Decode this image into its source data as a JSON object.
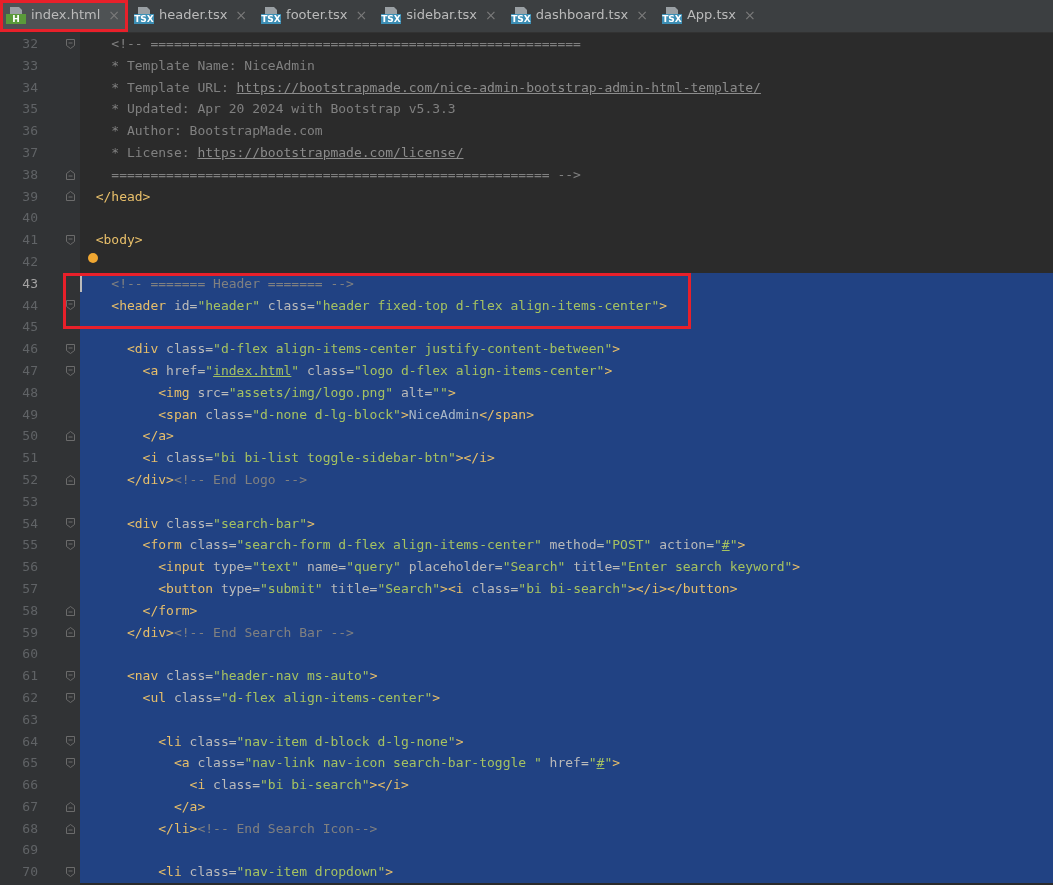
{
  "tabs": [
    {
      "label": "index.html",
      "badge": "H",
      "kind": "html",
      "selected": true,
      "boxed": true
    },
    {
      "label": "header.tsx",
      "badge": "TSX",
      "kind": "tsx",
      "selected": false,
      "boxed": false
    },
    {
      "label": "footer.tsx",
      "badge": "TSX",
      "kind": "tsx",
      "selected": false,
      "boxed": false
    },
    {
      "label": "sidebar.tsx",
      "badge": "TSX",
      "kind": "tsx",
      "selected": false,
      "boxed": false
    },
    {
      "label": "dashboard.tsx",
      "badge": "TSX",
      "kind": "tsx",
      "selected": false,
      "boxed": false
    },
    {
      "label": "App.tsx",
      "badge": "TSX",
      "kind": "tsx",
      "selected": false,
      "boxed": false
    }
  ],
  "close_glyph": "×",
  "lines": [
    {
      "number": "32",
      "kind": "fold-start",
      "selected": false,
      "boxed": false,
      "caret": false,
      "bulb": false,
      "tokens": [
        {
          "kind": "comment",
          "text": "  <!-- ======================================================="
        }
      ]
    },
    {
      "number": "33",
      "kind": "plain",
      "selected": false,
      "boxed": false,
      "caret": false,
      "bulb": false,
      "tokens": [
        {
          "kind": "comment",
          "text": "  * Template Name: NiceAdmin"
        }
      ]
    },
    {
      "number": "34",
      "kind": "plain",
      "selected": false,
      "boxed": false,
      "caret": false,
      "bulb": false,
      "tokens": [
        {
          "kind": "comment",
          "text": "  * Template URL: "
        },
        {
          "kind": "clink",
          "text": "https://bootstrapmade.com/nice-admin-bootstrap-admin-html-template/"
        }
      ]
    },
    {
      "number": "35",
      "kind": "plain",
      "selected": false,
      "boxed": false,
      "caret": false,
      "bulb": false,
      "tokens": [
        {
          "kind": "comment",
          "text": "  * Updated: Apr 20 2024 with Bootstrap v5.3.3"
        }
      ]
    },
    {
      "number": "36",
      "kind": "plain",
      "selected": false,
      "boxed": false,
      "caret": false,
      "bulb": false,
      "tokens": [
        {
          "kind": "comment",
          "text": "  * Author: BootstrapMade.com"
        }
      ]
    },
    {
      "number": "37",
      "kind": "plain",
      "selected": false,
      "boxed": false,
      "caret": false,
      "bulb": false,
      "tokens": [
        {
          "kind": "comment",
          "text": "  * License: "
        },
        {
          "kind": "clink",
          "text": "https://bootstrapmade.com/license/"
        }
      ]
    },
    {
      "number": "38",
      "kind": "fold-end",
      "selected": false,
      "boxed": false,
      "caret": false,
      "bulb": false,
      "tokens": [
        {
          "kind": "comment",
          "text": "  ======================================================== -->"
        }
      ]
    },
    {
      "number": "39",
      "kind": "fold-end",
      "selected": false,
      "boxed": false,
      "caret": false,
      "bulb": false,
      "tokens": [
        {
          "kind": "tag",
          "text": "</head>"
        }
      ]
    },
    {
      "number": "40",
      "kind": "plain",
      "selected": false,
      "boxed": false,
      "caret": false,
      "bulb": false
    },
    {
      "number": "41",
      "kind": "fold-start",
      "selected": false,
      "boxed": false,
      "caret": false,
      "bulb": false,
      "tokens": [
        {
          "kind": "tag",
          "text": "<body>"
        }
      ]
    },
    {
      "number": "42",
      "kind": "plain",
      "selected": false,
      "boxed": false,
      "caret": false,
      "bulb": true
    },
    {
      "number": "43",
      "kind": "plain",
      "selected": true,
      "boxed": true,
      "caret": true,
      "bulb": false,
      "tokens": [
        {
          "kind": "comment",
          "text": "  <!-- ======= Header ======= -->"
        }
      ]
    },
    {
      "number": "44",
      "kind": "fold-start",
      "selected": true,
      "boxed": true,
      "caret": false,
      "bulb": false,
      "tokens": [
        {
          "kind": "tag",
          "text": "  <header"
        },
        {
          "kind": "attr",
          "text": " id="
        },
        {
          "kind": "str",
          "text": "\"header\""
        },
        {
          "kind": "attr",
          "text": " class="
        },
        {
          "kind": "str",
          "text": "\"header fixed-top d-flex align-items-center\""
        },
        {
          "kind": "tag",
          "text": ">"
        }
      ]
    },
    {
      "number": "45",
      "kind": "plain",
      "selected": true,
      "boxed": false,
      "caret": false,
      "bulb": false
    },
    {
      "number": "46",
      "kind": "fold-start",
      "selected": true,
      "boxed": false,
      "caret": false,
      "bulb": false,
      "tokens": [
        {
          "kind": "tag",
          "text": "    <div"
        },
        {
          "kind": "attr",
          "text": " class="
        },
        {
          "kind": "str",
          "text": "\"d-flex align-items-center justify-content-between\""
        },
        {
          "kind": "tag",
          "text": ">"
        }
      ]
    },
    {
      "number": "47",
      "kind": "fold-start",
      "selected": true,
      "boxed": false,
      "caret": false,
      "bulb": false,
      "tokens": [
        {
          "kind": "tag",
          "text": "      <a"
        },
        {
          "kind": "attr",
          "text": " href="
        },
        {
          "kind": "str",
          "text": "\""
        },
        {
          "kind": "link",
          "text": "index.html"
        },
        {
          "kind": "str",
          "text": "\""
        },
        {
          "kind": "attr",
          "text": " class="
        },
        {
          "kind": "str",
          "text": "\"logo d-flex align-items-center\""
        },
        {
          "kind": "tag",
          "text": ">"
        }
      ]
    },
    {
      "number": "48",
      "kind": "plain",
      "selected": true,
      "boxed": false,
      "caret": false,
      "bulb": false,
      "tokens": [
        {
          "kind": "tag",
          "text": "        <img"
        },
        {
          "kind": "attr",
          "text": " src="
        },
        {
          "kind": "str",
          "text": "\"assets/img/logo.png\""
        },
        {
          "kind": "attr",
          "text": " alt="
        },
        {
          "kind": "str",
          "text": "\"\""
        },
        {
          "kind": "tag",
          "text": ">"
        }
      ]
    },
    {
      "number": "49",
      "kind": "plain",
      "selected": true,
      "boxed": false,
      "caret": false,
      "bulb": false,
      "tokens": [
        {
          "kind": "tag",
          "text": "        <span"
        },
        {
          "kind": "attr",
          "text": " class="
        },
        {
          "kind": "str",
          "text": "\"d-none d-lg-block\""
        },
        {
          "kind": "tag",
          "text": ">"
        },
        {
          "kind": "text",
          "text": "NiceAdmin"
        },
        {
          "kind": "tag",
          "text": "</span>"
        }
      ]
    },
    {
      "number": "50",
      "kind": "fold-end",
      "selected": true,
      "boxed": false,
      "caret": false,
      "bulb": false,
      "tokens": [
        {
          "kind": "tag",
          "text": "      </a>"
        }
      ]
    },
    {
      "number": "51",
      "kind": "plain",
      "selected": true,
      "boxed": false,
      "caret": false,
      "bulb": false,
      "tokens": [
        {
          "kind": "tag",
          "text": "      <i"
        },
        {
          "kind": "attr",
          "text": " class="
        },
        {
          "kind": "str",
          "text": "\"bi bi-list toggle-sidebar-btn\""
        },
        {
          "kind": "tag",
          "text": "></i>"
        }
      ]
    },
    {
      "number": "52",
      "kind": "fold-end",
      "selected": true,
      "boxed": false,
      "caret": false,
      "bulb": false,
      "tokens": [
        {
          "kind": "tag",
          "text": "    </div>"
        },
        {
          "kind": "comment",
          "text": "<!-- End Logo -->"
        }
      ]
    },
    {
      "number": "53",
      "kind": "plain",
      "selected": true,
      "boxed": false,
      "caret": false,
      "bulb": false
    },
    {
      "number": "54",
      "kind": "fold-start",
      "selected": true,
      "boxed": false,
      "caret": false,
      "bulb": false,
      "tokens": [
        {
          "kind": "tag",
          "text": "    <div"
        },
        {
          "kind": "attr",
          "text": " class="
        },
        {
          "kind": "str",
          "text": "\"search-bar\""
        },
        {
          "kind": "tag",
          "text": ">"
        }
      ]
    },
    {
      "number": "55",
      "kind": "fold-start",
      "selected": true,
      "boxed": false,
      "caret": false,
      "bulb": false,
      "tokens": [
        {
          "kind": "tag",
          "text": "      <form"
        },
        {
          "kind": "attr",
          "text": " class="
        },
        {
          "kind": "str",
          "text": "\"search-form d-flex align-items-center\""
        },
        {
          "kind": "attr",
          "text": " method="
        },
        {
          "kind": "str",
          "text": "\"POST\""
        },
        {
          "kind": "attr",
          "text": " action="
        },
        {
          "kind": "str",
          "text": "\""
        },
        {
          "kind": "link",
          "text": "#"
        },
        {
          "kind": "str",
          "text": "\""
        },
        {
          "kind": "tag",
          "text": ">"
        }
      ]
    },
    {
      "number": "56",
      "kind": "plain",
      "selected": true,
      "boxed": false,
      "caret": false,
      "bulb": false,
      "tokens": [
        {
          "kind": "tag",
          "text": "        <input"
        },
        {
          "kind": "attr",
          "text": " type="
        },
        {
          "kind": "str",
          "text": "\"text\""
        },
        {
          "kind": "attr",
          "text": " name="
        },
        {
          "kind": "str",
          "text": "\"query\""
        },
        {
          "kind": "attr",
          "text": " placeholder="
        },
        {
          "kind": "str",
          "text": "\"Search\""
        },
        {
          "kind": "attr",
          "text": " title="
        },
        {
          "kind": "str",
          "text": "\"Enter search keyword\""
        },
        {
          "kind": "tag",
          "text": ">"
        }
      ]
    },
    {
      "number": "57",
      "kind": "plain",
      "selected": true,
      "boxed": false,
      "caret": false,
      "bulb": false,
      "tokens": [
        {
          "kind": "tag",
          "text": "        <button"
        },
        {
          "kind": "attr",
          "text": " type="
        },
        {
          "kind": "str",
          "text": "\"submit\""
        },
        {
          "kind": "attr",
          "text": " title="
        },
        {
          "kind": "str",
          "text": "\"Search\""
        },
        {
          "kind": "tag",
          "text": "><i"
        },
        {
          "kind": "attr",
          "text": " class="
        },
        {
          "kind": "str",
          "text": "\"bi bi-search\""
        },
        {
          "kind": "tag",
          "text": "></i></button>"
        }
      ]
    },
    {
      "number": "58",
      "kind": "fold-end",
      "selected": true,
      "boxed": false,
      "caret": false,
      "bulb": false,
      "tokens": [
        {
          "kind": "tag",
          "text": "      </form>"
        }
      ]
    },
    {
      "number": "59",
      "kind": "fold-end",
      "selected": true,
      "boxed": false,
      "caret": false,
      "bulb": false,
      "tokens": [
        {
          "kind": "tag",
          "text": "    </div>"
        },
        {
          "kind": "comment",
          "text": "<!-- End Search Bar -->"
        }
      ]
    },
    {
      "number": "60",
      "kind": "plain",
      "selected": true,
      "boxed": false,
      "caret": false,
      "bulb": false
    },
    {
      "number": "61",
      "kind": "fold-start",
      "selected": true,
      "boxed": false,
      "caret": false,
      "bulb": false,
      "tokens": [
        {
          "kind": "tag",
          "text": "    <nav"
        },
        {
          "kind": "attr",
          "text": " class="
        },
        {
          "kind": "str",
          "text": "\"header-nav ms-auto\""
        },
        {
          "kind": "tag",
          "text": ">"
        }
      ]
    },
    {
      "number": "62",
      "kind": "fold-start",
      "selected": true,
      "boxed": false,
      "caret": false,
      "bulb": false,
      "tokens": [
        {
          "kind": "tag",
          "text": "      <ul"
        },
        {
          "kind": "attr",
          "text": " class="
        },
        {
          "kind": "str",
          "text": "\"d-flex align-items-center\""
        },
        {
          "kind": "tag",
          "text": ">"
        }
      ]
    },
    {
      "number": "63",
      "kind": "plain",
      "selected": true,
      "boxed": false,
      "caret": false,
      "bulb": false
    },
    {
      "number": "64",
      "kind": "fold-start",
      "selected": true,
      "boxed": false,
      "caret": false,
      "bulb": false,
      "tokens": [
        {
          "kind": "tag",
          "text": "        <li"
        },
        {
          "kind": "attr",
          "text": " class="
        },
        {
          "kind": "str",
          "text": "\"nav-item d-block d-lg-none\""
        },
        {
          "kind": "tag",
          "text": ">"
        }
      ]
    },
    {
      "number": "65",
      "kind": "fold-start",
      "selected": true,
      "boxed": false,
      "caret": false,
      "bulb": false,
      "tokens": [
        {
          "kind": "tag",
          "text": "          <a"
        },
        {
          "kind": "attr",
          "text": " class="
        },
        {
          "kind": "str",
          "text": "\"nav-link nav-icon search-bar-toggle \""
        },
        {
          "kind": "attr",
          "text": " href="
        },
        {
          "kind": "str",
          "text": "\""
        },
        {
          "kind": "link",
          "text": "#"
        },
        {
          "kind": "str",
          "text": "\""
        },
        {
          "kind": "tag",
          "text": ">"
        }
      ]
    },
    {
      "number": "66",
      "kind": "plain",
      "selected": true,
      "boxed": false,
      "caret": false,
      "bulb": false,
      "tokens": [
        {
          "kind": "tag",
          "text": "            <i"
        },
        {
          "kind": "attr",
          "text": " class="
        },
        {
          "kind": "str",
          "text": "\"bi bi-search\""
        },
        {
          "kind": "tag",
          "text": "></i>"
        }
      ]
    },
    {
      "number": "67",
      "kind": "fold-end",
      "selected": true,
      "boxed": false,
      "caret": false,
      "bulb": false,
      "tokens": [
        {
          "kind": "tag",
          "text": "          </a>"
        }
      ]
    },
    {
      "number": "68",
      "kind": "fold-end",
      "selected": true,
      "boxed": false,
      "caret": false,
      "bulb": false,
      "tokens": [
        {
          "kind": "tag",
          "text": "        </li>"
        },
        {
          "kind": "comment",
          "text": "<!-- End Search Icon-->"
        }
      ]
    },
    {
      "number": "69",
      "kind": "plain",
      "selected": true,
      "boxed": false,
      "caret": false,
      "bulb": false
    },
    {
      "number": "70",
      "kind": "fold-start",
      "selected": true,
      "boxed": false,
      "caret": false,
      "bulb": false,
      "tokens": [
        {
          "kind": "tag",
          "text": "        <li"
        },
        {
          "kind": "attr",
          "text": " class="
        },
        {
          "kind": "str",
          "text": "\"nav-item dropdown\""
        },
        {
          "kind": "tag",
          "text": ">"
        }
      ]
    }
  ]
}
